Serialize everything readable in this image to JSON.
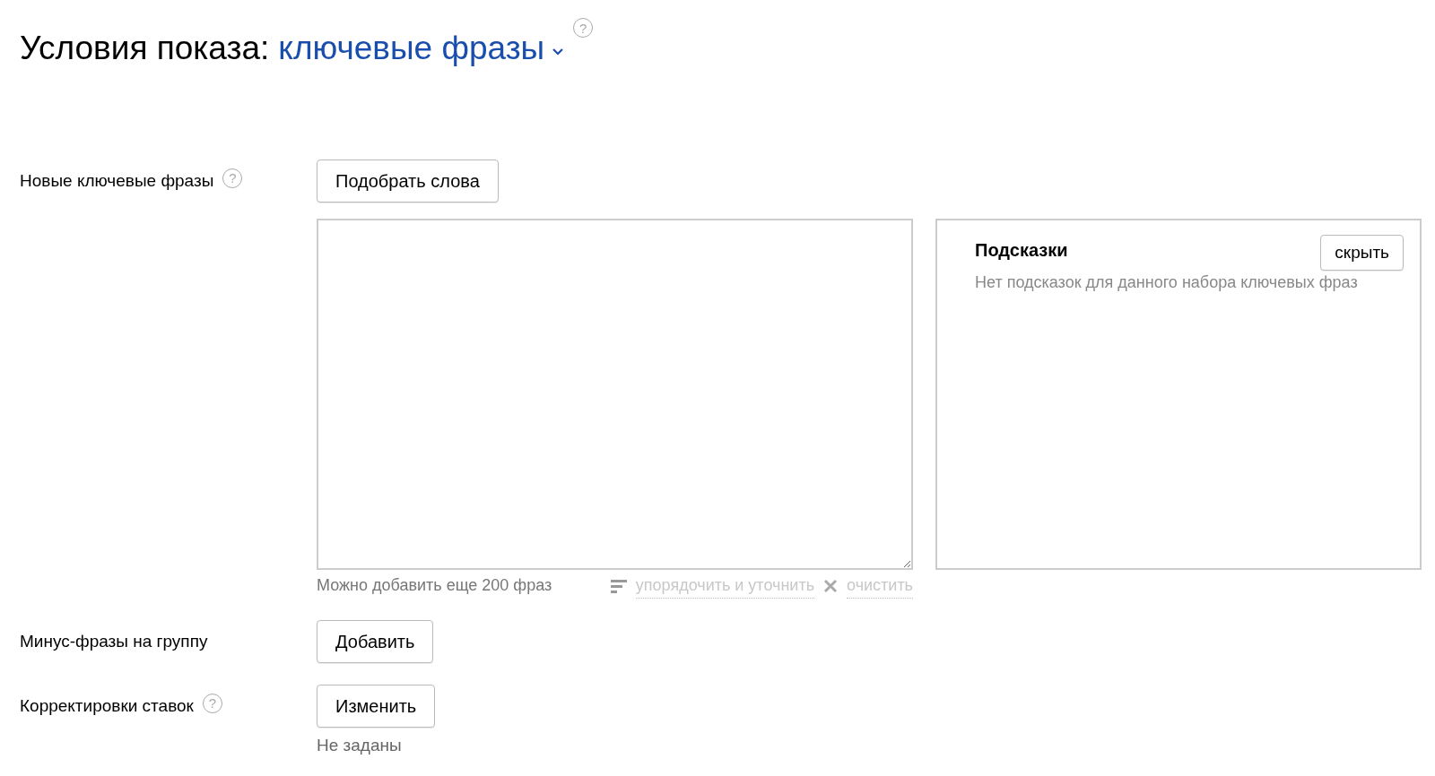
{
  "heading": {
    "prefix": "Условия показа:",
    "selector": "ключевые фразы",
    "help": "?"
  },
  "rows": [
    {
      "kind": "keywords",
      "label": "Новые ключевые фразы",
      "help": "?",
      "button": "Подобрать слова",
      "counter": "Можно добавить еще 200 фраз",
      "actions": [
        {
          "kind": "sort",
          "label": "упорядочить и уточнить",
          "disabled": true
        },
        {
          "kind": "clear",
          "label": "очистить",
          "disabled": true
        }
      ],
      "hints": {
        "title": "Подсказки",
        "hide_button": "скрыть",
        "message": "Нет подсказок для данного набора ключевых фраз"
      }
    },
    {
      "kind": "button",
      "label": "Минус-фразы на группу",
      "button": "Добавить"
    },
    {
      "kind": "button",
      "label": "Корректировки ставок",
      "help": "?",
      "button": "Изменить",
      "note": "Не заданы"
    }
  ]
}
